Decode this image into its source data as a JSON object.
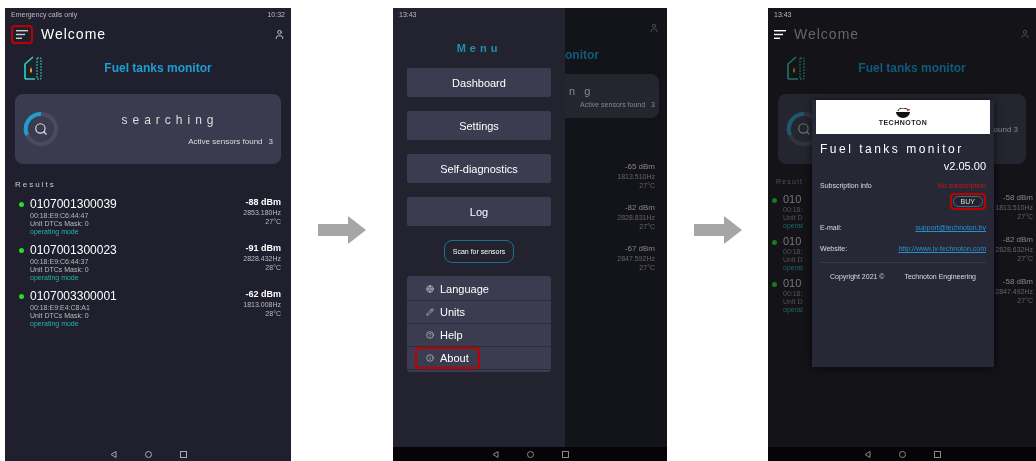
{
  "home_screen": {
    "status_bar": {
      "left": "Emergency calls only",
      "right": "10:32"
    },
    "header": {
      "title": "Welcome",
      "menu_highlighted": true
    },
    "app_title": "Fuel tanks monitor",
    "search_card": {
      "status": "searching",
      "label": "Active sensors found",
      "count": "3"
    },
    "results_title": "Results",
    "sensors": [
      {
        "id": "0107001300039",
        "mac": "00:18:E9:C6:44:47",
        "dtc": "Unit DTCs Mask: 0",
        "mode": "operating mode",
        "rssi": "-88 dBm",
        "freq": "2853.180Hz",
        "temp": "27°C"
      },
      {
        "id": "0107001300023",
        "mac": "00:18:E9:C6:44:37",
        "dtc": "Unit DTCs Mask: 0",
        "mode": "operating mode",
        "rssi": "-91 dBm",
        "freq": "2828.432Hz",
        "temp": "28°C"
      },
      {
        "id": "0107003300001",
        "mac": "00:18:E9:E4:C8:A1",
        "dtc": "Unit DTCs Mask: 0",
        "mode": "operating mode",
        "rssi": "-62 dBm",
        "freq": "1813.008Hz",
        "temp": "28°C"
      }
    ]
  },
  "menu_screen": {
    "status_bar": {
      "left": "13:43"
    },
    "menu_title": "Menu",
    "buttons": [
      "Dashboard",
      "Settings",
      "Self-diagnostics",
      "Log"
    ],
    "scan_button": "Scan for sensors",
    "options": [
      {
        "kind": "language",
        "label": "Language",
        "highlighted": false
      },
      {
        "kind": "units",
        "label": "Units",
        "highlighted": false
      },
      {
        "kind": "help",
        "label": "Help",
        "highlighted": false
      },
      {
        "kind": "about",
        "label": "About",
        "highlighted": true
      }
    ],
    "background": {
      "title_fragment": "onitor",
      "status_fragment": "n g",
      "sensors_label": "Active sensors found",
      "count": "3",
      "readings": [
        {
          "rssi": "-65 dBm",
          "freq": "1813.510Hz",
          "temp": "27°C"
        },
        {
          "rssi": "-82 dBm",
          "freq": "2828.831Hz",
          "temp": "27°C"
        },
        {
          "rssi": "-67 dBm",
          "freq": "2847.592Hz",
          "temp": "27°C"
        }
      ]
    }
  },
  "about_screen": {
    "status_bar": {
      "left": "13:43"
    },
    "background": {
      "title": "Welcome",
      "app_title": "Fuel tanks monitor",
      "count_fragment": "ound  3",
      "results_fragment": "Result",
      "rows": [
        {
          "id_fragment": "010",
          "mac_fragment": "00:18:",
          "dtc_fragment": "Unit D",
          "mode_fragment": "operat",
          "rssi": "-58 dBm",
          "freq": "1813.510Hz",
          "temp": "27°C"
        },
        {
          "id_fragment": "010",
          "mac_fragment": "00:18:",
          "dtc_fragment": "Unit D",
          "mode_fragment": "operat",
          "rssi": "-82 dBm",
          "freq": "2828.632Hz",
          "temp": "27°C"
        },
        {
          "id_fragment": "010",
          "mac_fragment": "00:18:",
          "dtc_fragment": "Unit D",
          "mode_fragment": "operat",
          "rssi": "-58 dBm",
          "freq": "2847.492Hz",
          "temp": "27°C"
        }
      ]
    },
    "dialog": {
      "brand": "TECHNOTON",
      "title": "Fuel tanks monitor",
      "version": "v2.05.00",
      "subscription_label": "Subscription info",
      "subscription_value": "No subscription",
      "buy_button": "BUY",
      "buy_highlighted": true,
      "email_label": "E-mail:",
      "email": "support@technoton.by",
      "website_label": "Website:",
      "website": "http://www.jv-technoton.com",
      "copyright": "Copyright 2021 ©",
      "company": "Technoton Engineering"
    }
  }
}
